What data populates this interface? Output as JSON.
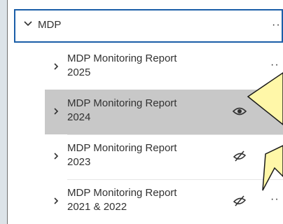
{
  "tree": {
    "root": {
      "label": "MDP",
      "more": "··"
    },
    "items": [
      {
        "label_line1": "MDP Monitoring Report",
        "label_line2": "2025",
        "visibility": "none",
        "more": "··"
      },
      {
        "label_line1": "MDP Monitoring Report",
        "label_line2": "2024",
        "visibility": "visible",
        "more": "··"
      },
      {
        "label_line1": "MDP Monitoring Report",
        "label_line2": "2023",
        "visibility": "hidden",
        "more": "··"
      },
      {
        "label_line1": "MDP Monitoring Report",
        "label_line2": "2021 & 2022",
        "visibility": "hidden",
        "more": "··"
      }
    ]
  },
  "icons": {
    "root_chevron": "chevron-down-icon",
    "item_chevron": "chevron-right-icon",
    "visible": "eye-icon",
    "hidden": "eye-slash-icon"
  },
  "colors": {
    "selected_row": "#c8c8c8",
    "focus_border": "#1b5ea8",
    "callout_fill": "#fff7a8",
    "background": "#dce3e8"
  }
}
